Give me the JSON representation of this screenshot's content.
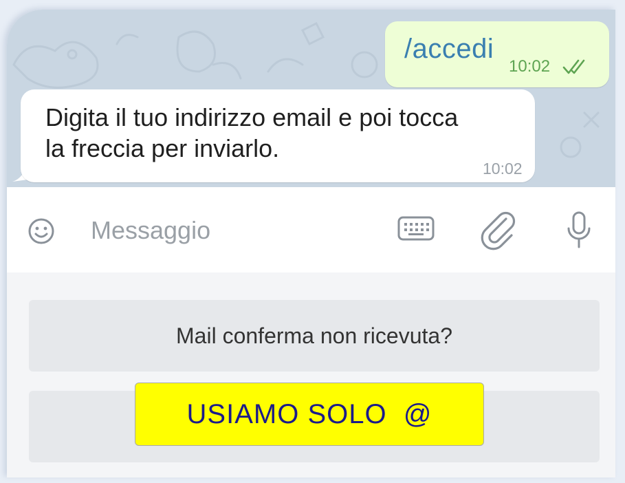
{
  "chat": {
    "outgoing": {
      "text": "/accedi",
      "time": "10:02",
      "status_icon": "double-check-icon"
    },
    "incoming": {
      "line1": "Digita il tuo indirizzo email e poi tocca",
      "line2": "la freccia per inviarlo.",
      "time": "10:02"
    }
  },
  "composer": {
    "placeholder": "Messaggio",
    "icons": [
      "emoji-icon",
      "keyboard-icon",
      "paperclip-icon",
      "microphone-icon"
    ]
  },
  "reply_keyboard": {
    "buttons": [
      "Mail conferma non ricevuta?",
      ""
    ]
  },
  "banner": {
    "text": "USIAMO SOLO  @"
  },
  "colors": {
    "chat_bg": "#c9d6e2",
    "outgoing_bubble": "#eefed6",
    "outgoing_text": "#3a7fb0",
    "outgoing_time": "#5ea452",
    "banner_bg": "#ffff00",
    "banner_text": "#1b1b8a"
  }
}
